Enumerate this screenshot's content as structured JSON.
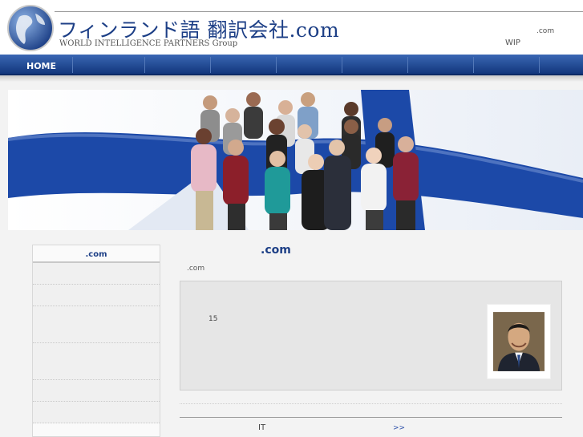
{
  "header": {
    "title": "フィンランド語 翻訳会社.com",
    "subtitle": "WORLD INTELLIGENCE PARTNERS Group",
    "domain": ".com",
    "wip": "WIP"
  },
  "nav": {
    "home_label": "HOME"
  },
  "sidebar": {
    "title": ".com"
  },
  "main": {
    "title": ".com",
    "domain": ".com",
    "box_number": "15"
  },
  "bottom": {
    "it": "IT",
    "more": ">>"
  },
  "colors": {
    "brand_blue": "#1d3f86",
    "nav_blue": "#12367c",
    "flag_blue": "#1c49a8"
  },
  "icons": [
    "globe-icon"
  ]
}
